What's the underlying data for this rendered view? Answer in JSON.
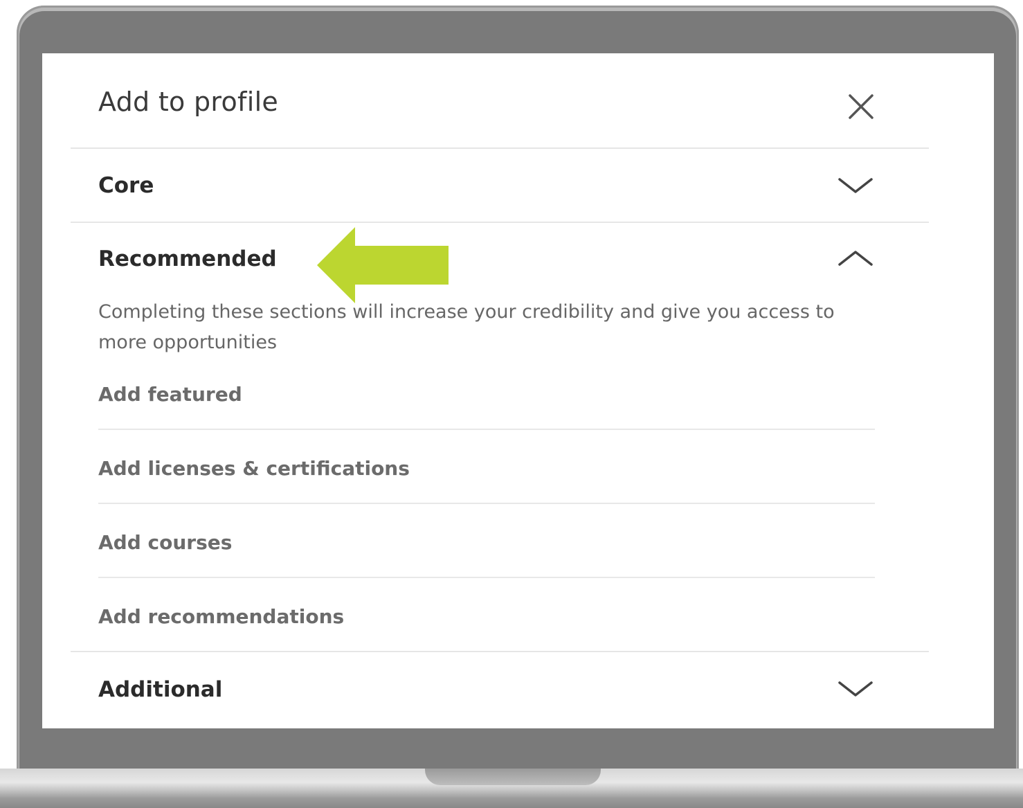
{
  "dialog": {
    "title": "Add to profile",
    "close_icon": "close-icon"
  },
  "sections": {
    "core": {
      "label": "Core",
      "icon": "chevron-down-icon",
      "expanded": false
    },
    "recommended": {
      "label": "Recommended",
      "icon": "chevron-up-icon",
      "expanded": true,
      "description": "Completing these sections will increase your credibility and give you access to more opportunities",
      "items": [
        {
          "label": "Add featured"
        },
        {
          "label": "Add licenses & certifications"
        },
        {
          "label": "Add courses"
        },
        {
          "label": "Add recommendations"
        }
      ]
    },
    "additional": {
      "label": "Additional",
      "icon": "chevron-down-icon",
      "expanded": false
    }
  },
  "annotation": {
    "icon": "arrow-left-icon",
    "color": "#bcd630"
  },
  "colors": {
    "frame": "#7a7a7a",
    "screen": "#ffffff",
    "divider": "#e6e6e6"
  }
}
